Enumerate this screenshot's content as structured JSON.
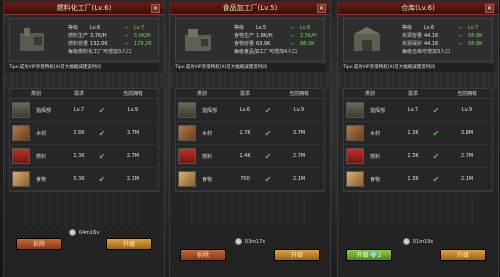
{
  "panels": [
    {
      "title": "燃料化工厂(Lv.6)",
      "stats": [
        {
          "k": "等级",
          "v": "Lv.6",
          "n": "Lv.7"
        },
        {
          "k": "燃料生产",
          "v": "3.7K/H",
          "n": "5.0K/H"
        },
        {
          "k": "燃料容量",
          "v": "132.0K",
          "n": "179.2K"
        }
      ],
      "note": "每级燃料化工厂可增加3人口",
      "tips": "Tips:成为VIP享受特权(X)可大幅缩减建造时间",
      "header": [
        "类别",
        "需求",
        "",
        "当前拥有"
      ],
      "rows": [
        {
          "name": "指挥部",
          "req": "Lv.7",
          "have": "Lv.9"
        },
        {
          "name": "木材",
          "req": "2.6K",
          "have": "3.7M"
        },
        {
          "name": "燃料",
          "req": "1.3K",
          "have": "2.7M"
        },
        {
          "name": "食物",
          "req": "5.3K",
          "have": "2.1M"
        }
      ],
      "time": "04m16s",
      "btn_left": "拆除",
      "btn_right": "升级"
    },
    {
      "title": "食品加工厂(Lv.5)",
      "stats": [
        {
          "k": "等级",
          "v": "Lv.5",
          "n": "Lv.6"
        },
        {
          "k": "食物生产",
          "v": "1.8K/H",
          "n": "2.5K/H"
        },
        {
          "k": "食物容量",
          "v": "63.0K",
          "n": "88.0K"
        }
      ],
      "note": "每级食品加工厂可增加4人口",
      "tips": "Tips:成为VIP享受特权(X)可大幅缩减建造时间",
      "header": [
        "类别",
        "需求",
        "",
        "当前拥有"
      ],
      "rows": [
        {
          "name": "指挥部",
          "req": "Lv.6",
          "have": "Lv.9"
        },
        {
          "name": "木材",
          "req": "2.7K",
          "have": "3.7M"
        },
        {
          "name": "燃料",
          "req": "1.4K",
          "have": "2.7M"
        },
        {
          "name": "食物",
          "req": "700",
          "have": "2.1M"
        }
      ],
      "time": "03m17s",
      "btn_left": "拆除",
      "btn_right": "升级"
    },
    {
      "title": "仓库(Lv.6)",
      "stats": [
        {
          "k": "等级",
          "v": "Lv.6",
          "n": "Lv.7"
        },
        {
          "k": "资源容量",
          "v": "44.1K",
          "n": "58.8K"
        },
        {
          "k": "资源保护",
          "v": "44.1K",
          "n": "58.8K"
        }
      ],
      "note": "每级仓库可增加3人口",
      "tips": "Tips:成为VIP享受特权(X)可大幅缩减建造时间",
      "header": [
        "类别",
        "需求",
        "",
        "当前拥有"
      ],
      "rows": [
        {
          "name": "指挥部",
          "req": "Lv.7",
          "have": "Lv.9"
        },
        {
          "name": "木材",
          "req": "1.3K",
          "have": "3.8M"
        },
        {
          "name": "燃料",
          "req": "1.3K",
          "have": "2.7M"
        },
        {
          "name": "食物",
          "req": "1.3K",
          "have": "2.1M"
        }
      ],
      "time": "01m19s",
      "btn_left": "升级",
      "btn_left_gems": "2",
      "btn_right": "升级"
    }
  ],
  "colors": {
    "accent_red": "#6e1b14",
    "positive_green": "#7ed957"
  }
}
